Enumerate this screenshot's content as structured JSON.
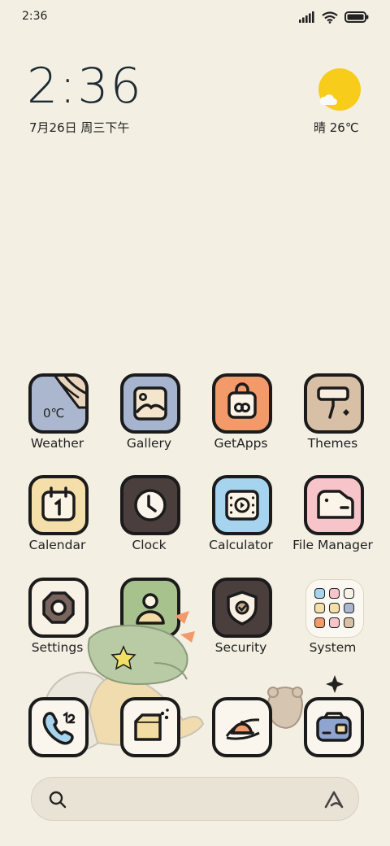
{
  "status_bar": {
    "time": "2:36"
  },
  "clock_widget": {
    "time": "2:36",
    "date": "7月26日 周三下午"
  },
  "weather_widget": {
    "condition_temp": "晴 26℃"
  },
  "apps": [
    {
      "id": "weather",
      "label": "Weather",
      "tile_text": "0℃"
    },
    {
      "id": "gallery",
      "label": "Gallery"
    },
    {
      "id": "getapps",
      "label": "GetApps"
    },
    {
      "id": "themes",
      "label": "Themes"
    },
    {
      "id": "calendar",
      "label": "Calendar"
    },
    {
      "id": "clock",
      "label": "Clock"
    },
    {
      "id": "calculator",
      "label": "Calculator"
    },
    {
      "id": "file-manager",
      "label": "File Manager"
    },
    {
      "id": "settings",
      "label": "Settings"
    },
    {
      "id": "contacts",
      "label": "Contacts"
    },
    {
      "id": "security",
      "label": "Security"
    },
    {
      "id": "system",
      "label": "System"
    }
  ],
  "dock": [
    "phone-icon",
    "messages-icon",
    "browser-icon",
    "camera-icon"
  ],
  "colors": {
    "background": "#f4efe3",
    "weather_tile": "#aab7cf",
    "gallery_tile": "#a6b4cf",
    "getapps_tile": "#f29a6a",
    "themes_tile": "#d8c0a6",
    "calendar_tile": "#f4deaa",
    "clock_tile": "#4a3f3d",
    "calculator_tile": "#a6d3ee",
    "file_manager_tile": "#f6c4c9",
    "settings_tile": "#f7f1e6",
    "contacts_tile": "#a8c28d",
    "security_tile": "#4a3f3d",
    "sun": "#f7cc1a"
  }
}
